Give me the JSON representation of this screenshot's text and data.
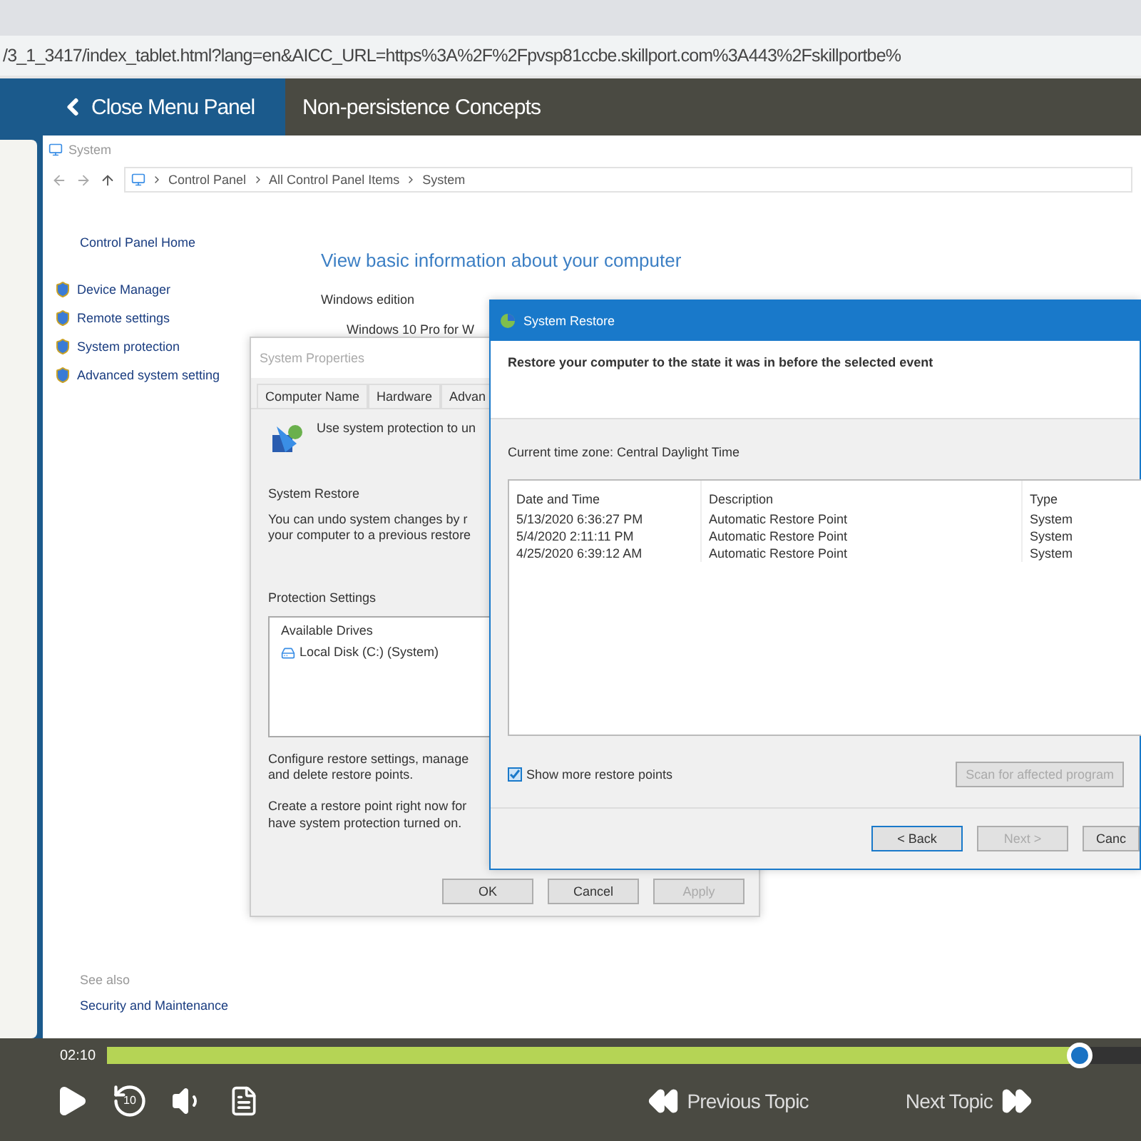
{
  "browser": {
    "url": "/3_1_3417/index_tablet.html?lang=en&AICC_URL=https%3A%2F%2Fpvsp81ccbe.skillport.com%3A443%2Fskillportbe%"
  },
  "header": {
    "menu_button": "Close Menu Panel",
    "title": "Non-persistence Concepts"
  },
  "system_window": {
    "title": "System",
    "breadcrumb": [
      "Control Panel",
      "All Control Panel Items",
      "System"
    ],
    "home_link": "Control Panel Home",
    "links": [
      "Device Manager",
      "Remote settings",
      "System protection",
      "Advanced system setting"
    ],
    "heading": "View basic information about your computer",
    "section": "Windows edition",
    "edition": "Windows 10 Pro for W",
    "see_also": "See also",
    "see_also_links": [
      "Security and Maintenance"
    ]
  },
  "properties_dialog": {
    "title": "System Properties",
    "tabs": [
      "Computer Name",
      "Hardware",
      "Advan"
    ],
    "intro": "Use system protection to un",
    "restore_group": "System Restore",
    "restore_text": [
      "You can undo system changes by r",
      "your computer to a previous restore"
    ],
    "protection_group": "Protection Settings",
    "drives_header": "Available Drives",
    "drives": [
      "Local Disk (C:) (System)"
    ],
    "configure_text": [
      "Configure restore settings, manage",
      "and delete restore points."
    ],
    "create_text": [
      "Create a restore point right now for",
      "have system protection turned on."
    ],
    "buttons": [
      {
        "label": "OK",
        "disabled": false
      },
      {
        "label": "Cancel",
        "disabled": false
      },
      {
        "label": "Apply",
        "disabled": true
      }
    ]
  },
  "restore_dialog": {
    "title": "System Restore",
    "heading": "Restore your computer to the state it was in before the selected event",
    "timezone": "Current time zone: Central Daylight Time",
    "columns": [
      "Date and Time",
      "Description",
      "Type"
    ],
    "rows": [
      [
        "5/13/2020 6:36:27 PM",
        "Automatic Restore Point",
        "System"
      ],
      [
        "5/4/2020 2:11:11 PM",
        "Automatic Restore Point",
        "System"
      ],
      [
        "4/25/2020 6:39:12 AM",
        "Automatic Restore Point",
        "System"
      ]
    ],
    "show_more": {
      "label": "Show more restore points",
      "checked": true
    },
    "scan_button": {
      "label": "Scan for affected program",
      "disabled": true
    },
    "buttons": [
      {
        "label": "< Back",
        "disabled": false,
        "focused": true
      },
      {
        "label": "Next >",
        "disabled": true,
        "focused": false
      },
      {
        "label": "Canc",
        "disabled": false,
        "focused": false
      }
    ]
  },
  "player": {
    "time": "02:10",
    "level": 0.94,
    "replay_label": "10",
    "previous": "Previous Topic",
    "next": "Next Topic"
  }
}
